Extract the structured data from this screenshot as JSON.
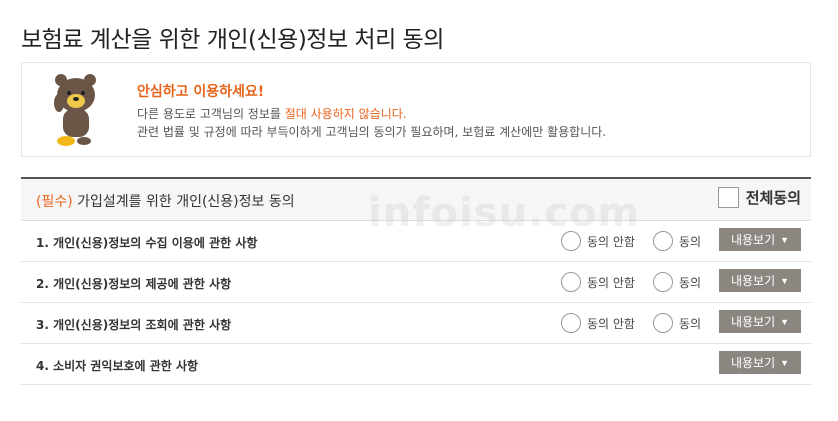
{
  "page": {
    "title": "보험료 계산을 위한 개인(신용)정보 처리 동의"
  },
  "notice": {
    "heading": "안심하고 이용하세요!",
    "line1_before": "다른 용도로 고객님의 정보를 ",
    "line1_highlight": "절대 사용하지 않습니다.",
    "line2": "관련 법률 및 규정에 따라 부득이하게 고객님의 동의가 필요하며, 보험료 계산에만 활용합니다."
  },
  "agreement": {
    "required_tag": "(필수)",
    "title": "가입설계를 위한 개인(신용)정보 동의",
    "all_agree_label": "전체동의",
    "disagree_label": "동의 안함",
    "agree_label": "동의",
    "detail_label": "내용보기",
    "rows": [
      {
        "title": "1. 개인(신용)정보의 수집 이용에 관한 사항"
      },
      {
        "title": "2. 개인(신용)정보의 제공에 관한 사항"
      },
      {
        "title": "3. 개인(신용)정보의 조회에 관한 사항"
      },
      {
        "title": "4. 소비자 권익보호에 관한 사항"
      }
    ]
  },
  "watermark": "infoisu.com",
  "colors": {
    "accent": "#e8641b",
    "button": "#8c8680"
  }
}
